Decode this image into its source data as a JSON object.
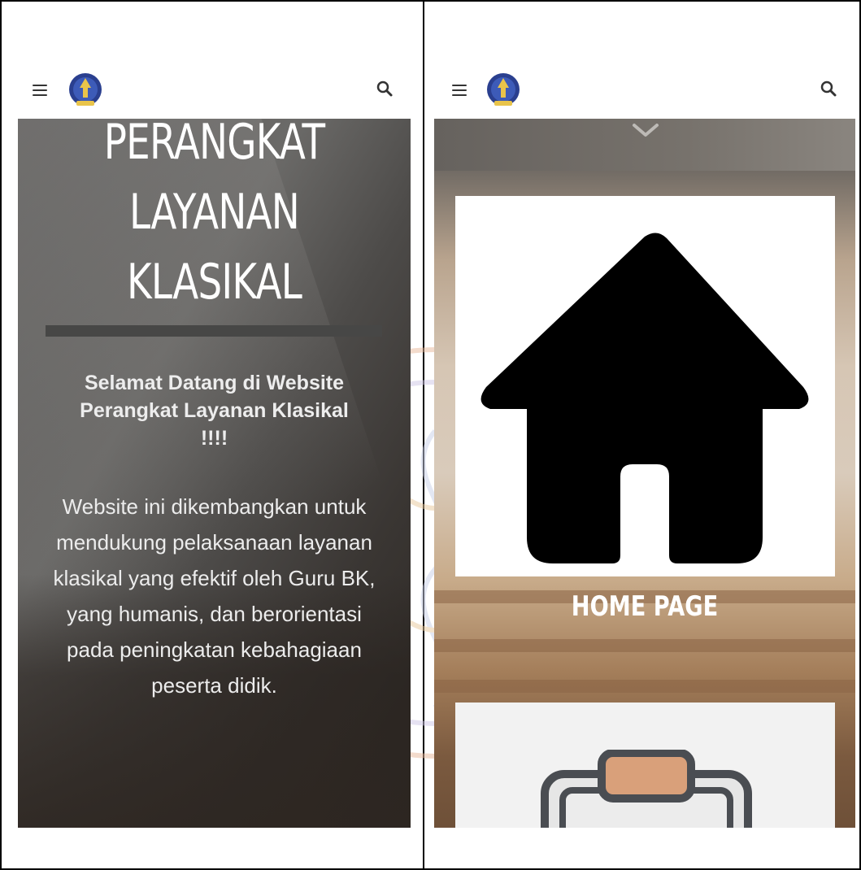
{
  "left_screen": {
    "hero": {
      "title_lines": [
        "PERANGKAT",
        "LAYANAN",
        "KLASIKAL"
      ],
      "subtitle": "Selamat Datang di Website Perangkat Layanan Klasikal !!!!",
      "description": "Website ini dikembangkan untuk mendukung pelaksanaan layanan klasikal yang efektif oleh Guru BK, yang humanis, dan berorientasi pada peningkatan kebahagiaan peserta didik."
    }
  },
  "right_screen": {
    "home_card": {
      "label": "HOME PAGE",
      "icon": "house-icon"
    },
    "next_card": {
      "icon": "clipboard-icon",
      "accent_color": "#d9a07a"
    }
  },
  "topbar": {
    "menu_icon": "hamburger-menu-icon",
    "logo": "university-logo",
    "search_icon": "search-icon"
  },
  "colors": {
    "topbar_bg": "#ffffff",
    "hero_text": "#ffffff",
    "divider": "#474746",
    "card_bg": "#ffffff"
  }
}
